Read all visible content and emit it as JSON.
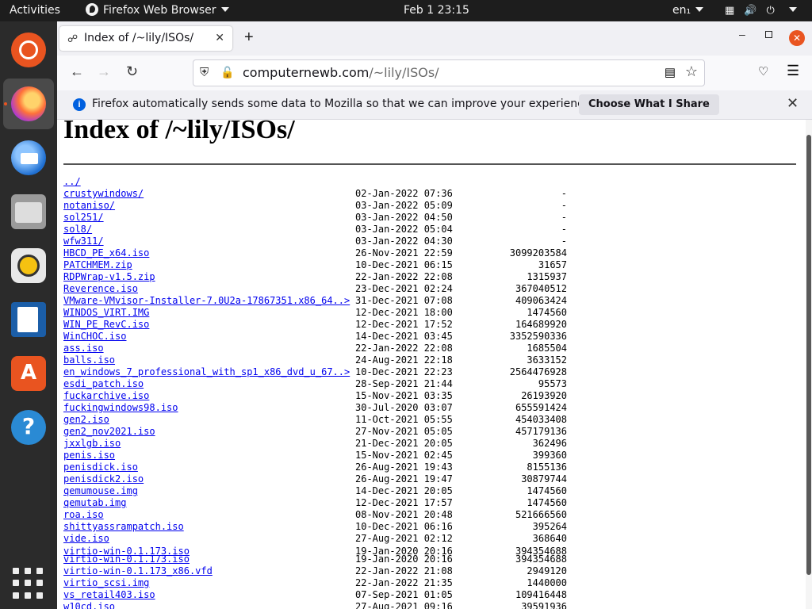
{
  "topbar": {
    "activities": "Activities",
    "app_name": "Firefox Web Browser",
    "clock": "Feb 1  23:15",
    "lang": "en₁"
  },
  "dock": [
    "ubuntu-logo-icon",
    "firefox-icon",
    "thunderbird-icon",
    "files-icon",
    "rhythmbox-icon",
    "libreoffice-writer-icon",
    "software-center-icon",
    "help-icon",
    "show-apps-grid-icon"
  ],
  "browser": {
    "tab_title": "Index of /~lily/ISOs/",
    "url_host": "computernewb.com",
    "url_path": "/~lily/ISOs/"
  },
  "notification": {
    "text": "Firefox automatically sends some data to Mozilla so that we can improve your experience.",
    "button": "Choose What I Share"
  },
  "page": {
    "title": "Index of /~lily/ISOs/",
    "parent": "../",
    "entries": [
      {
        "name": "crustywindows/",
        "date": "02-Jan-2022 07:36",
        "size": "-"
      },
      {
        "name": "notaniso/",
        "date": "03-Jan-2022 05:09",
        "size": "-"
      },
      {
        "name": "sol251/",
        "date": "03-Jan-2022 04:50",
        "size": "-"
      },
      {
        "name": "sol8/",
        "date": "03-Jan-2022 05:04",
        "size": "-"
      },
      {
        "name": "wfw311/",
        "date": "03-Jan-2022 04:30",
        "size": "-"
      },
      {
        "name": "HBCD_PE_x64.iso",
        "date": "26-Nov-2021 22:59",
        "size": "3099203584"
      },
      {
        "name": "PATCHMEM.zip",
        "date": "10-Dec-2021 06:15",
        "size": "31657"
      },
      {
        "name": "RDPWrap-v1.5.zip",
        "date": "22-Jan-2022 22:08",
        "size": "1315937"
      },
      {
        "name": "Reverence.iso",
        "date": "23-Dec-2021 02:24",
        "size": "367040512"
      },
      {
        "name": "VMware-VMvisor-Installer-7.0U2a-17867351.x86_64..>",
        "date": "31-Dec-2021 07:08",
        "size": "409063424"
      },
      {
        "name": "WINDOS_VIRT.IMG",
        "date": "12-Dec-2021 18:00",
        "size": "1474560"
      },
      {
        "name": "WIN_PE_RevC.iso",
        "date": "12-Dec-2021 17:52",
        "size": "164689920"
      },
      {
        "name": "WinCHOC.iso",
        "date": "14-Dec-2021 03:45",
        "size": "3352590336"
      },
      {
        "name": "ass.iso",
        "date": "22-Jan-2022 22:08",
        "size": "1685504"
      },
      {
        "name": "balls.iso",
        "date": "24-Aug-2021 22:18",
        "size": "3633152"
      },
      {
        "name": "en_windows_7_professional_with_sp1_x86_dvd_u_67..>",
        "date": "10-Dec-2021 22:23",
        "size": "2564476928"
      },
      {
        "name": "esdi_patch.iso",
        "date": "28-Sep-2021 21:44",
        "size": "95573"
      },
      {
        "name": "fuckarchive.iso",
        "date": "15-Nov-2021 03:35",
        "size": "26193920"
      },
      {
        "name": "fuckingwindows98.iso",
        "date": "30-Jul-2020 03:07",
        "size": "655591424"
      },
      {
        "name": "gen2.iso",
        "date": "11-Oct-2021 05:55",
        "size": "454033408"
      },
      {
        "name": "gen2_nov2021.iso",
        "date": "27-Nov-2021 05:05",
        "size": "457179136"
      },
      {
        "name": "jxxlgb.iso",
        "date": "21-Dec-2021 20:05",
        "size": "362496"
      },
      {
        "name": "penis.iso",
        "date": "15-Nov-2021 02:45",
        "size": "399360"
      },
      {
        "name": "penisdick.iso",
        "date": "26-Aug-2021 19:43",
        "size": "8155136"
      },
      {
        "name": "penisdick2.iso",
        "date": "26-Aug-2021 19:47",
        "size": "30879744"
      },
      {
        "name": "qemumouse.img",
        "date": "14-Dec-2021 20:05",
        "size": "1474560"
      },
      {
        "name": "qemutab.img",
        "date": "12-Dec-2021 17:57",
        "size": "1474560"
      },
      {
        "name": "roa.iso",
        "date": "08-Nov-2021 20:48",
        "size": "521666560"
      },
      {
        "name": "shittyassrampatch.iso",
        "date": "10-Dec-2021 06:16",
        "size": "395264"
      },
      {
        "name": "vide.iso",
        "date": "27-Aug-2021 02:12",
        "size": "368640"
      },
      {
        "name": "virtio-win-0.1.173.iso",
        "date": "19-Jan-2020 20:16",
        "size": "394354688"
      },
      {
        "name": "virtio-win-0.1.173.iso",
        "date": "19-Jan-2020 20:16",
        "size": "394354688"
      },
      {
        "name": "virtio-win-0.1.173_x86.vfd",
        "date": "22-Jan-2022 21:08",
        "size": "2949120"
      },
      {
        "name": "virtio_scsi.img",
        "date": "22-Jan-2022 21:35",
        "size": "1440000"
      },
      {
        "name": "vs_retail403.iso",
        "date": "07-Sep-2021 01:05",
        "size": "109416448"
      },
      {
        "name": "w10cd.iso",
        "date": "27-Aug-2021 09:16",
        "size": "39591936"
      }
    ]
  }
}
